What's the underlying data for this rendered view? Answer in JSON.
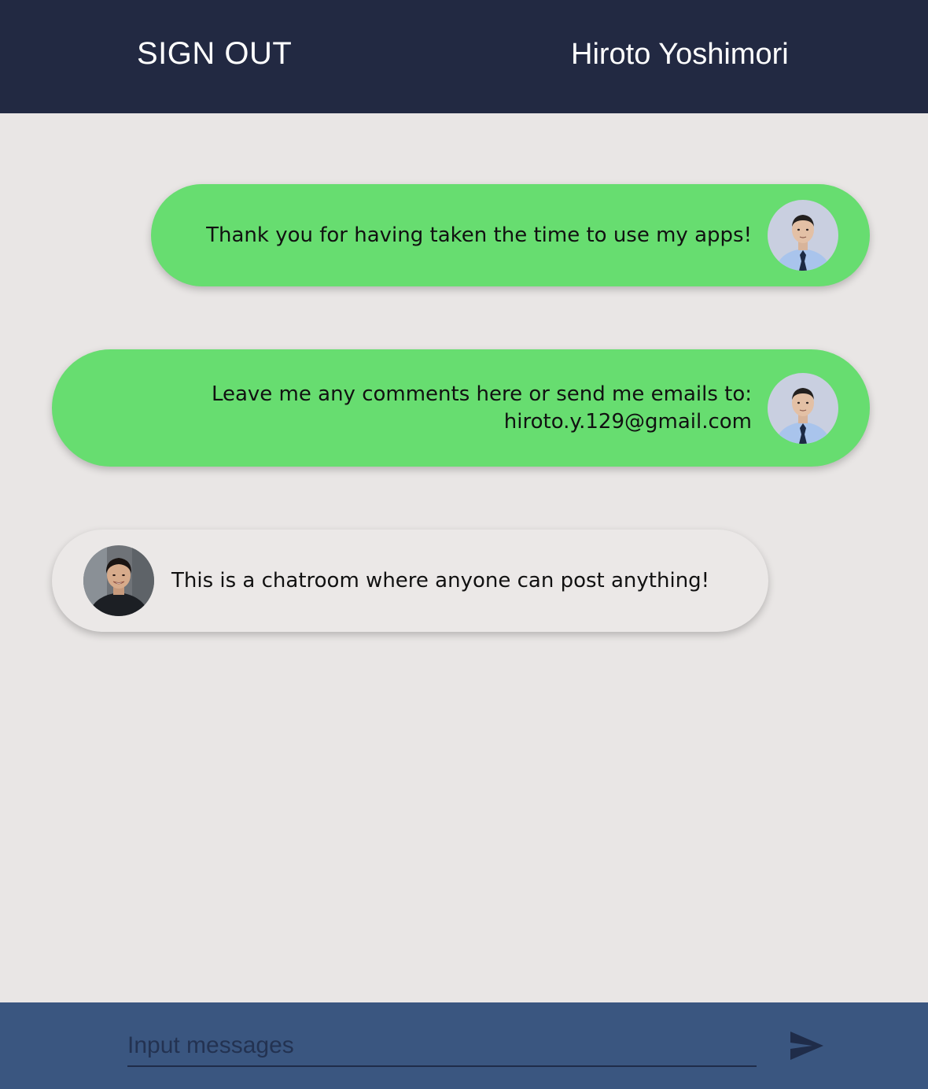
{
  "header": {
    "sign_out_label": "SIGN OUT",
    "user_name": "Hiroto Yoshimori",
    "background_color": "#222942"
  },
  "messages": [
    {
      "sender": "self",
      "lines": [
        "Thank you for having taken the time to use my apps!"
      ],
      "bubble_color": "#67dd70",
      "avatar_icon": "avatar-icon"
    },
    {
      "sender": "self",
      "lines": [
        "Leave me any comments here or send me emails to:",
        "hiroto.y.129@gmail.com"
      ],
      "bubble_color": "#67dd70",
      "avatar_icon": "avatar-icon"
    },
    {
      "sender": "other",
      "lines": [
        "This is a chatroom where anyone can post anything!"
      ],
      "bubble_color": "#ebe8e7",
      "avatar_icon": "avatar-icon"
    }
  ],
  "composer": {
    "input_value": "",
    "placeholder": "Input messages",
    "send_icon": "send-icon",
    "background_color": "#3a5680"
  }
}
